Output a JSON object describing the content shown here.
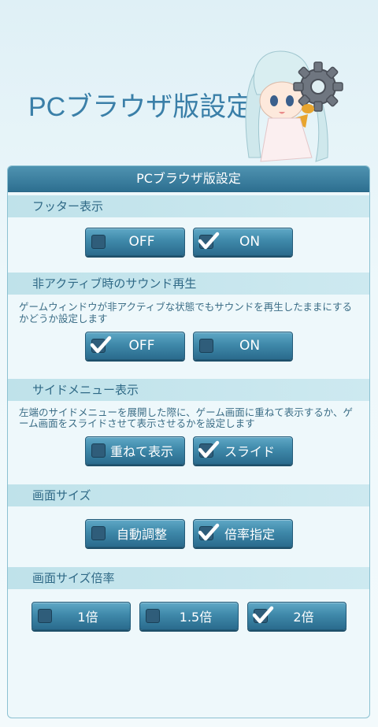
{
  "page": {
    "title": "PCブラウザ版設定"
  },
  "panel": {
    "title": "PCブラウザ版設定"
  },
  "sections": [
    {
      "title": "フッター表示",
      "description": "",
      "options": [
        {
          "label": "OFF",
          "checked": false
        },
        {
          "label": "ON",
          "checked": true
        }
      ]
    },
    {
      "title": "非アクティブ時のサウンド再生",
      "description": "ゲームウィンドウが非アクティブな状態でもサウンドを再生したままにするかどうか設定します",
      "options": [
        {
          "label": "OFF",
          "checked": true
        },
        {
          "label": "ON",
          "checked": false
        }
      ]
    },
    {
      "title": "サイドメニュー表示",
      "description": "左端のサイドメニューを展開した際に、ゲーム画面に重ねて表示するか、ゲーム画面をスライドさせて表示させるかを設定します",
      "options": [
        {
          "label": "重ねて表示",
          "checked": false
        },
        {
          "label": "スライド",
          "checked": true
        }
      ]
    },
    {
      "title": "画面サイズ",
      "description": "",
      "options": [
        {
          "label": "自動調整",
          "checked": false
        },
        {
          "label": "倍率指定",
          "checked": true
        }
      ]
    },
    {
      "title": "画面サイズ倍率",
      "description": "",
      "options": [
        {
          "label": "1倍",
          "checked": false
        },
        {
          "label": "1.5倍",
          "checked": false
        },
        {
          "label": "2倍",
          "checked": true
        }
      ]
    }
  ],
  "icons": {
    "check": "checkmark-icon",
    "gear": "gear-icon"
  },
  "colors": {
    "accent": "#3a7fa8",
    "button": "#3f89aa",
    "section_bg": "#c6e6ee"
  }
}
